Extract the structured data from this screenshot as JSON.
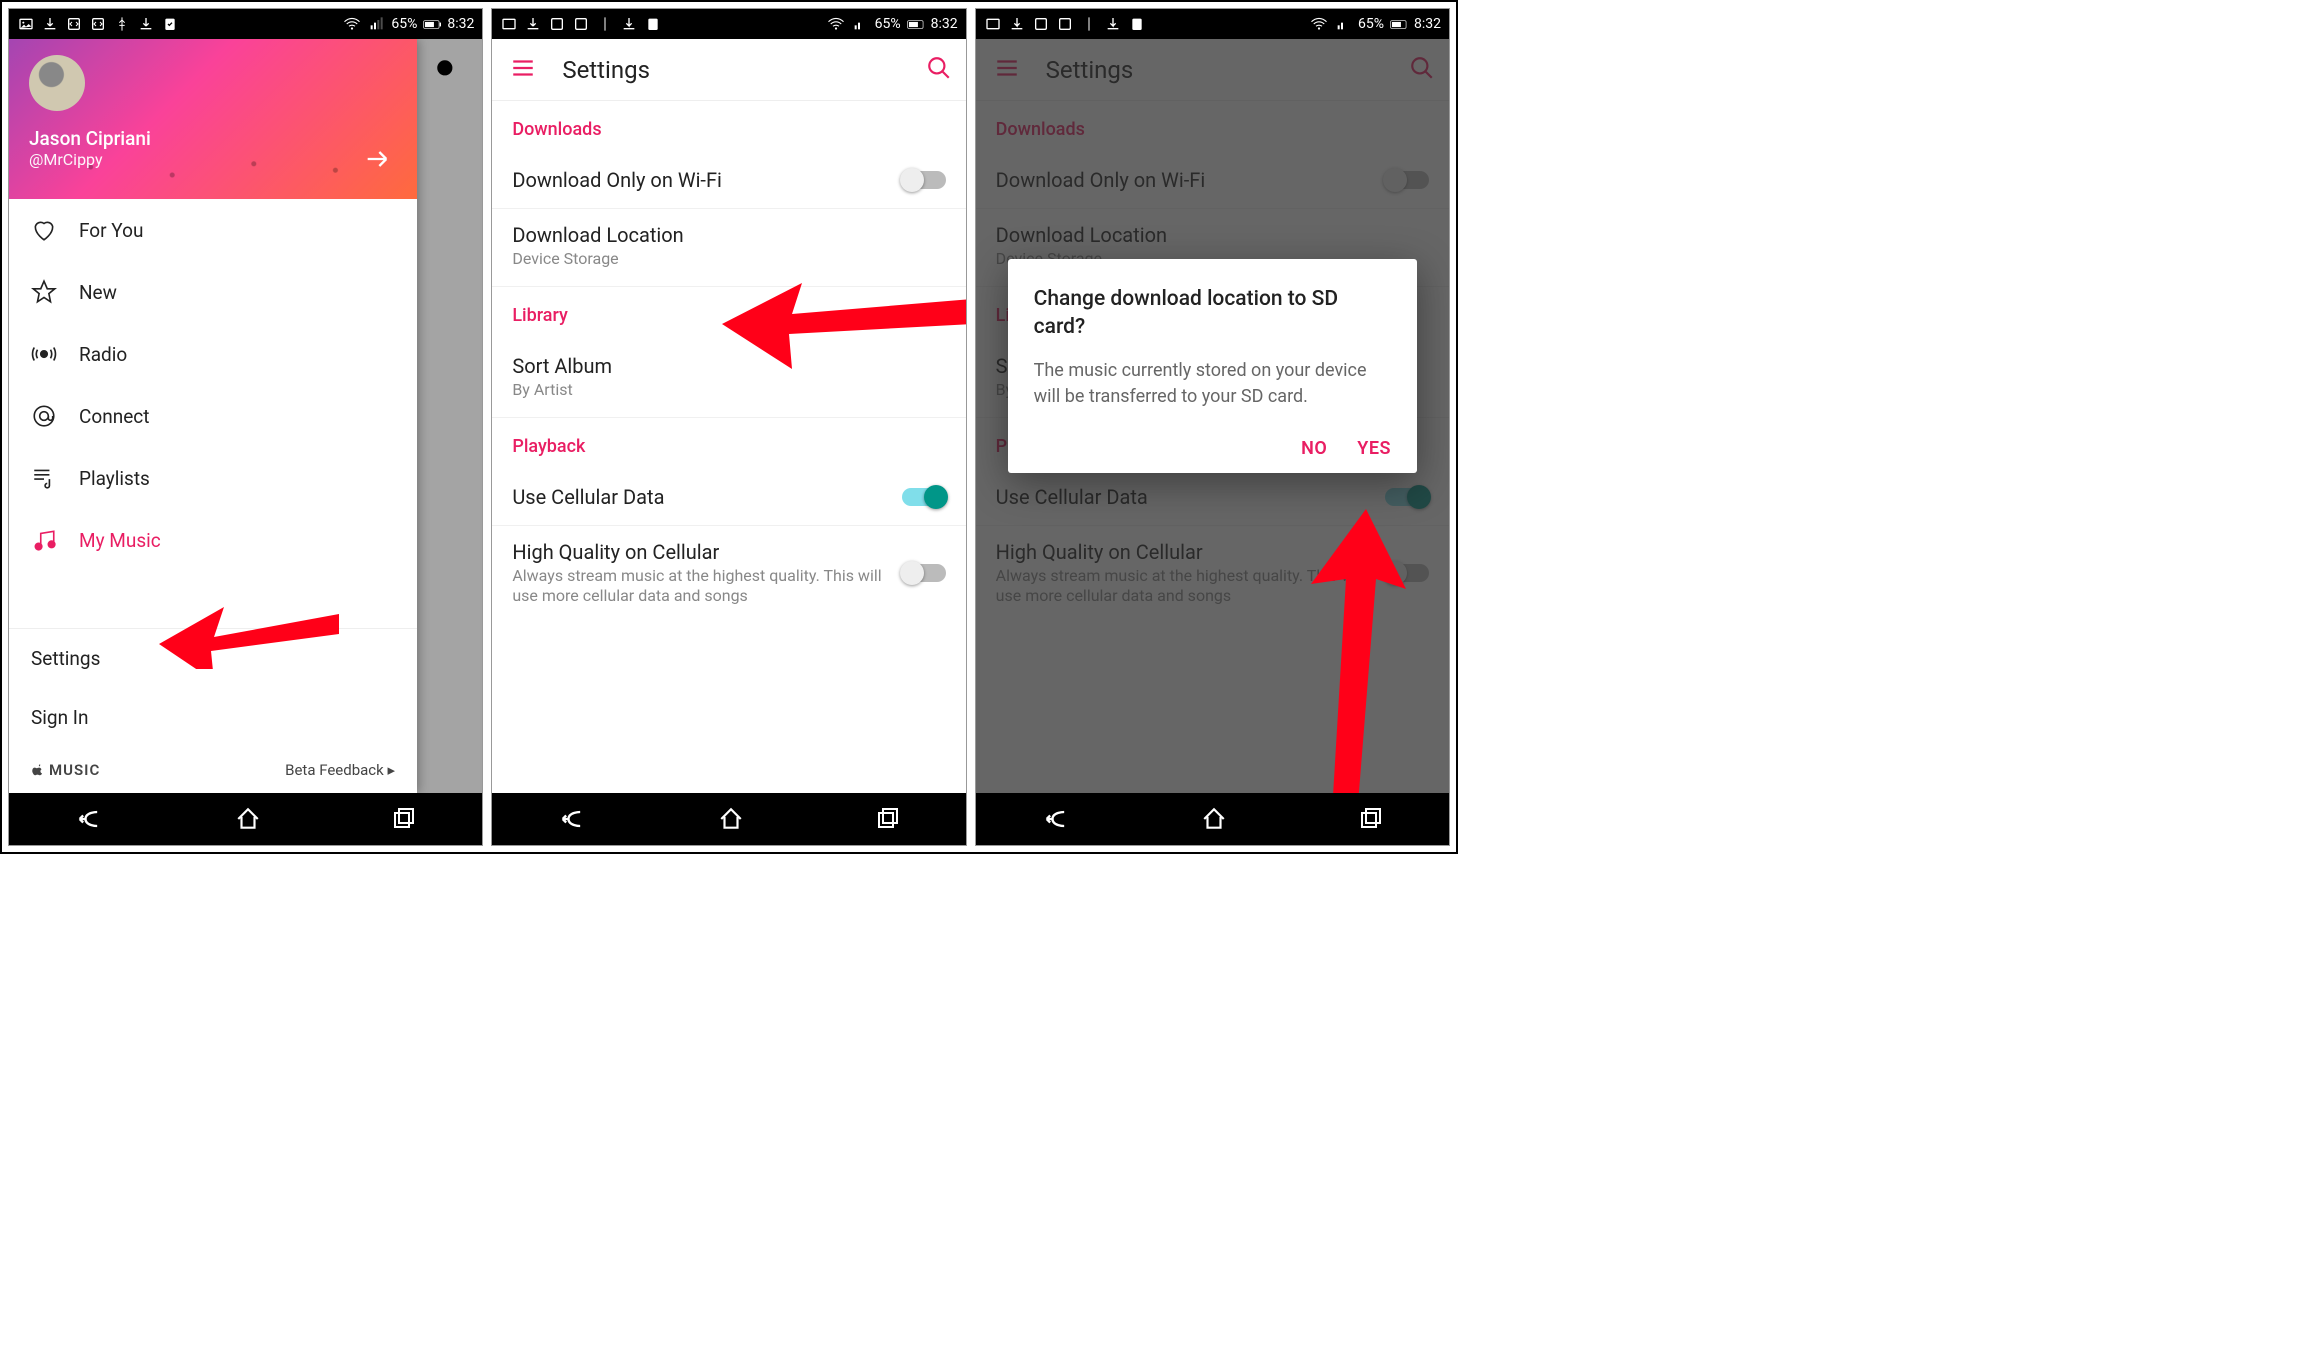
{
  "statusbar": {
    "battery": "65%",
    "time": "8:32"
  },
  "drawer": {
    "userName": "Jason Cipriani",
    "handle": "@MrCippy",
    "items": [
      {
        "label": "For You",
        "icon": "heart-icon"
      },
      {
        "label": "New",
        "icon": "star-icon"
      },
      {
        "label": "Radio",
        "icon": "radio-icon"
      },
      {
        "label": "Connect",
        "icon": "at-icon"
      },
      {
        "label": "Playlists",
        "icon": "playlist-icon"
      },
      {
        "label": "My Music",
        "icon": "music-icon"
      }
    ],
    "settings": "Settings",
    "signin": "Sign In",
    "brand": "MUSIC",
    "beta": "Beta Feedback ▸"
  },
  "settings": {
    "title": "Settings",
    "sections": {
      "downloads": "Downloads",
      "library": "Library",
      "playback": "Playback"
    },
    "items": {
      "wifi": "Download Only on Wi-Fi",
      "location": "Download Location",
      "locationSub": "Device Storage",
      "sortAlbum": "Sort Album",
      "sortAlbumSub": "By Artist",
      "cellular": "Use Cellular Data",
      "hq": "High Quality on Cellular",
      "hqSub": "Always stream music at the highest quality. This will use more cellular data and songs"
    }
  },
  "dialog": {
    "title": "Change download location to SD card?",
    "body": "The music currently stored on your device will be transferred to your SD card.",
    "no": "NO",
    "yes": "YES"
  }
}
